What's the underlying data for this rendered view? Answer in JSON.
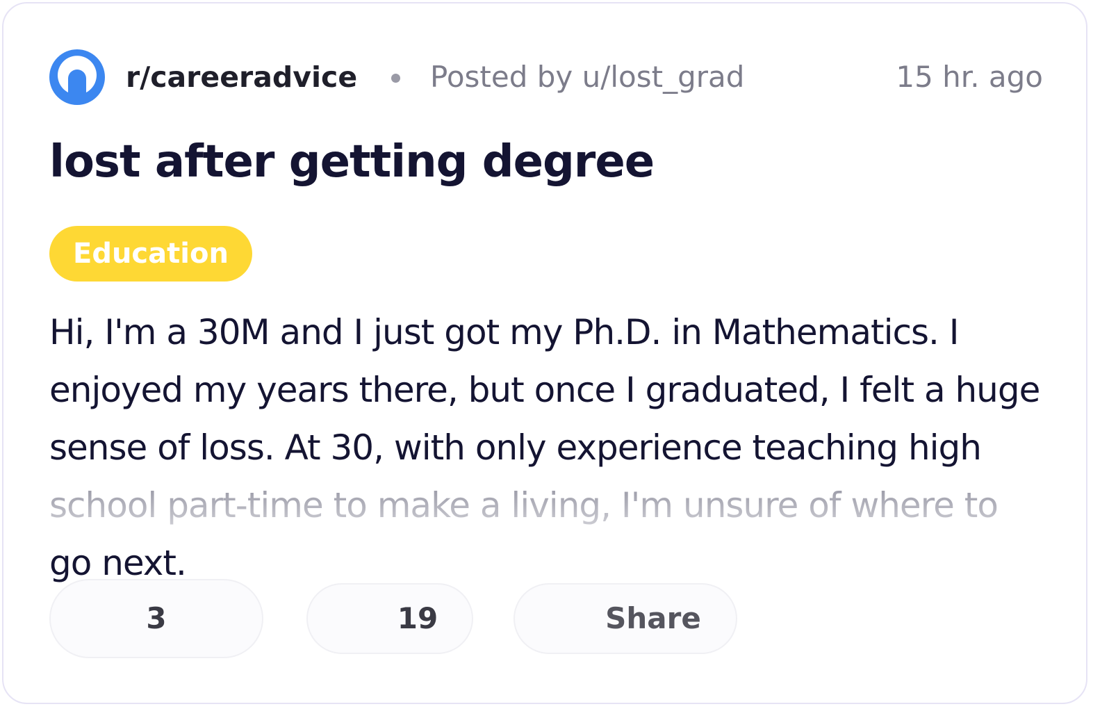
{
  "post": {
    "subreddit": "r/careeradvice",
    "posted_by": "Posted by u/lost_grad",
    "time_ago": "15 hr. ago",
    "title": "lost after getting degree",
    "tag": "Education",
    "body": "Hi, I'm a 30M and I just got my Ph.D. in Mathematics. I enjoyed my years there, but once I graduated, I felt a huge sense of loss. At 30, with only experience teaching high school part-time to make a living, I'm unsure of where to go next."
  },
  "actions": {
    "votes": "3",
    "comments": "19",
    "share_label": "Share"
  },
  "colors": {
    "accent_blue": "#3c87f0",
    "tag_yellow": "#fed834",
    "title_text": "#141432",
    "meta_text": "#7c7c8a"
  },
  "icons": {
    "community_avatar": "community-avatar-icon"
  }
}
